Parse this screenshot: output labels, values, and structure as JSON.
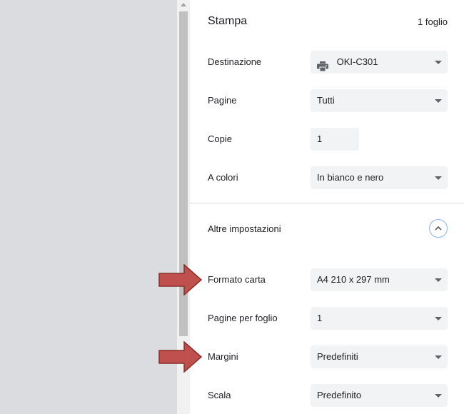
{
  "header": {
    "title": "Stampa",
    "sheet_count": "1 foglio"
  },
  "settings": {
    "destination": {
      "label": "Destinazione",
      "value": "OKI-C301",
      "icon": "printer-icon"
    },
    "pages": {
      "label": "Pagine",
      "value": "Tutti"
    },
    "copies": {
      "label": "Copie",
      "value": "1"
    },
    "color": {
      "label": "A colori",
      "value": "In bianco e nero"
    }
  },
  "more_settings": {
    "label": "Altre impostazioni",
    "icon": "chevron-up-icon"
  },
  "advanced": {
    "paper_size": {
      "label": "Formato carta",
      "value": "A4 210 x 297 mm"
    },
    "pages_per_sheet": {
      "label": "Pagine per foglio",
      "value": "1"
    },
    "margins": {
      "label": "Margini",
      "value": "Predefiniti"
    },
    "scale": {
      "label": "Scala",
      "value": "Predefinito"
    }
  },
  "annotations": {
    "arrow_color": "#c0504d",
    "arrow_border": "#8b2d2a"
  }
}
